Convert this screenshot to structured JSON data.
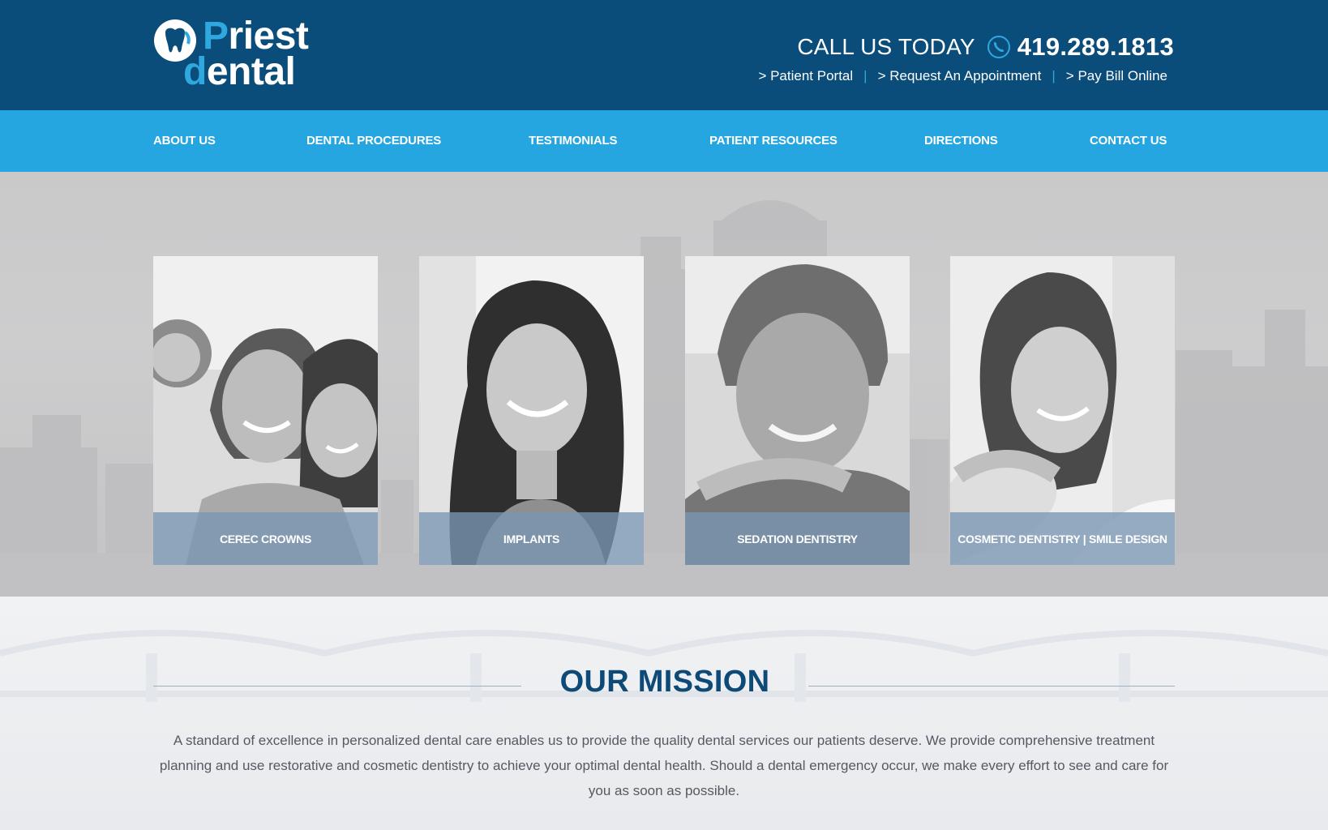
{
  "brand": {
    "line1_first": "P",
    "line1_rest": "riest",
    "line2_first": "d",
    "line2_rest": "ental",
    "accent_color": "#2fa8e0",
    "header_color": "#0a4c7a",
    "nav_color": "#25a6e0"
  },
  "header": {
    "call_label": "CALL US TODAY",
    "phone_icon": "phone-icon",
    "phone_number": "419.289.1813",
    "links": [
      {
        "label": "> Patient Portal"
      },
      {
        "label": "> Request An Appointment"
      },
      {
        "label": "> Pay Bill Online"
      }
    ],
    "separator": "|"
  },
  "nav": {
    "items": [
      {
        "label": "ABOUT US"
      },
      {
        "label": "DENTAL PROCEDURES"
      },
      {
        "label": "TESTIMONIALS"
      },
      {
        "label": "PATIENT RESOURCES"
      },
      {
        "label": "DIRECTIONS"
      },
      {
        "label": "CONTACT US"
      }
    ]
  },
  "services": [
    {
      "label": "CEREC CROWNS"
    },
    {
      "label": "IMPLANTS"
    },
    {
      "label": "SEDATION DENTISTRY"
    },
    {
      "label": "COSMETIC DENTISTRY | SMILE DESIGN"
    }
  ],
  "mission": {
    "title": "OUR MISSION",
    "text": "A standard of excellence in personalized dental care enables us to provide the quality dental services our patients deserve. We provide comprehensive treatment planning and use restorative and cosmetic dentistry to achieve your optimal dental health. Should a dental emergency occur, we make every effort to see and care for you as soon as possible."
  }
}
